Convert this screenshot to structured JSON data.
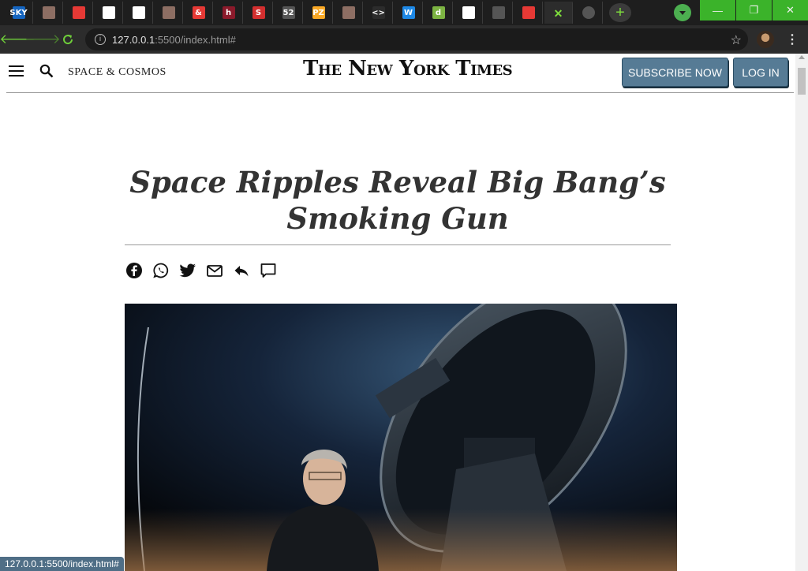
{
  "browser": {
    "tabs": [
      {
        "icon": "sky-news-favicon-icon",
        "glyph": "SKY",
        "color": "#1565c0"
      },
      {
        "icon": "badger-favicon-icon",
        "glyph": "",
        "color": "#8d6e63"
      },
      {
        "icon": "cubes-favicon-icon",
        "glyph": "",
        "color": "#e53935"
      },
      {
        "icon": "drop-favicon-icon",
        "glyph": "",
        "color": "#ffffff"
      },
      {
        "icon": "drop-favicon-icon",
        "glyph": "",
        "color": "#ffffff"
      },
      {
        "icon": "badger-favicon-icon",
        "glyph": "",
        "color": "#8d6e63"
      },
      {
        "icon": "ampersand-favicon-icon",
        "glyph": "&",
        "color": "#e53935"
      },
      {
        "icon": "h-favicon-icon",
        "glyph": "h",
        "color": "#8b1a2b"
      },
      {
        "icon": "s-favicon-icon",
        "glyph": "S",
        "color": "#d32f2f"
      },
      {
        "icon": "fifty-two-favicon-icon",
        "glyph": "52",
        "color": "#555555"
      },
      {
        "icon": "pz-favicon-icon",
        "glyph": "PZ",
        "color": "#f9a825"
      },
      {
        "icon": "badger-favicon-icon",
        "glyph": "",
        "color": "#8d6e63"
      },
      {
        "icon": "code-favicon-icon",
        "glyph": "<>",
        "color": "#2c2c2c"
      },
      {
        "icon": "w-favicon-icon",
        "glyph": "W",
        "color": "#1e88e5"
      },
      {
        "icon": "d-favicon-icon",
        "glyph": "d",
        "color": "#7cb342"
      },
      {
        "icon": "github-favicon-icon",
        "glyph": "",
        "color": "#ffffff"
      },
      {
        "icon": "globe-favicon-icon",
        "glyph": "",
        "color": "#555555"
      },
      {
        "icon": "youtube-favicon-icon",
        "glyph": "",
        "color": "#e53935"
      }
    ],
    "active_tab_close": "✕",
    "new_tab": "+",
    "url_host": "127.0.0.1",
    "url_rest": ":5500/index.html#",
    "status_url": "127.0.0.1:5500/index.html#",
    "window_controls": {
      "minimize": "—",
      "restore": "❐",
      "close": "✕"
    }
  },
  "header": {
    "section": "SPACE & COSMOS",
    "masthead": "The New York Times",
    "subscribe_label": "SUBSCRIBE NOW",
    "login_label": "LOG IN"
  },
  "article": {
    "headline": "Space Ripples Reveal Big Bang’s Smoking Gun",
    "share_icons": [
      "facebook-icon",
      "whatsapp-icon",
      "twitter-icon",
      "email-icon",
      "share-icon",
      "comment-icon"
    ]
  },
  "colors": {
    "accent_green": "#7ddb3c",
    "button_blue": "#567b95",
    "status_tip_bg": "#4f6e86"
  }
}
